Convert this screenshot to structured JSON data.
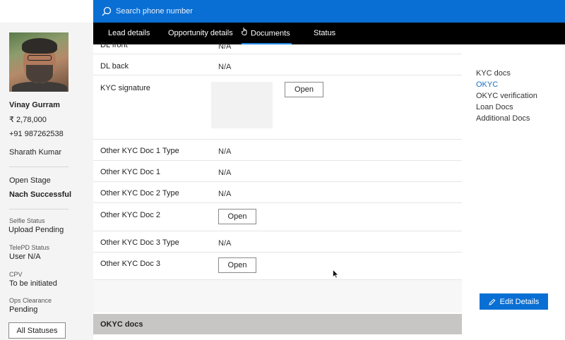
{
  "search": {
    "placeholder": "Search phone number"
  },
  "profile": {
    "name": "Vinay Gurram",
    "amount": "₹ 2,78,000",
    "phone": "+91 987262538",
    "agent": "Sharath Kumar",
    "stage_label": "Open Stage",
    "stage_value": "Nach Successful",
    "statuses": [
      {
        "label": "Selfie Status",
        "value": "Upload Pending"
      },
      {
        "label": "TelePD Status",
        "value": "User N/A"
      },
      {
        "label": "CPV",
        "value": "To be initiated"
      },
      {
        "label": "Ops Clearance",
        "value": "Pending"
      }
    ],
    "all_statuses_label": "All Statuses"
  },
  "nav": {
    "tabs": [
      {
        "label": "Lead details"
      },
      {
        "label": "Opportunity details"
      },
      {
        "label": "Documents"
      },
      {
        "label": "Status"
      }
    ]
  },
  "documents": {
    "rows": [
      {
        "label": "DL front",
        "value": "N/A"
      },
      {
        "label": "DL back",
        "value": "N/A"
      },
      {
        "label": "KYC signature",
        "value": ""
      },
      {
        "label": "Other KYC Doc 1 Type",
        "value": "N/A"
      },
      {
        "label": "Other KYC Doc 1",
        "value": "N/A"
      },
      {
        "label": "Other KYC Doc 2 Type",
        "value": "N/A"
      },
      {
        "label": "Other KYC Doc 2",
        "value": ""
      },
      {
        "label": "Other KYC Doc 3 Type",
        "value": "N/A"
      },
      {
        "label": "Other KYC Doc 3",
        "value": ""
      }
    ],
    "open_label": "Open",
    "section_header": "OKYC docs"
  },
  "side_nav": {
    "items": [
      {
        "label": "KYC docs"
      },
      {
        "label": "OKYC"
      },
      {
        "label": "OKYC verification"
      },
      {
        "label": "Loan Docs"
      },
      {
        "label": "Additional Docs"
      }
    ],
    "edit_label": "Edit Details"
  },
  "colors": {
    "accent": "#0a6fd4",
    "nav_bg": "#000000",
    "link_active": "#1a6fc4"
  }
}
